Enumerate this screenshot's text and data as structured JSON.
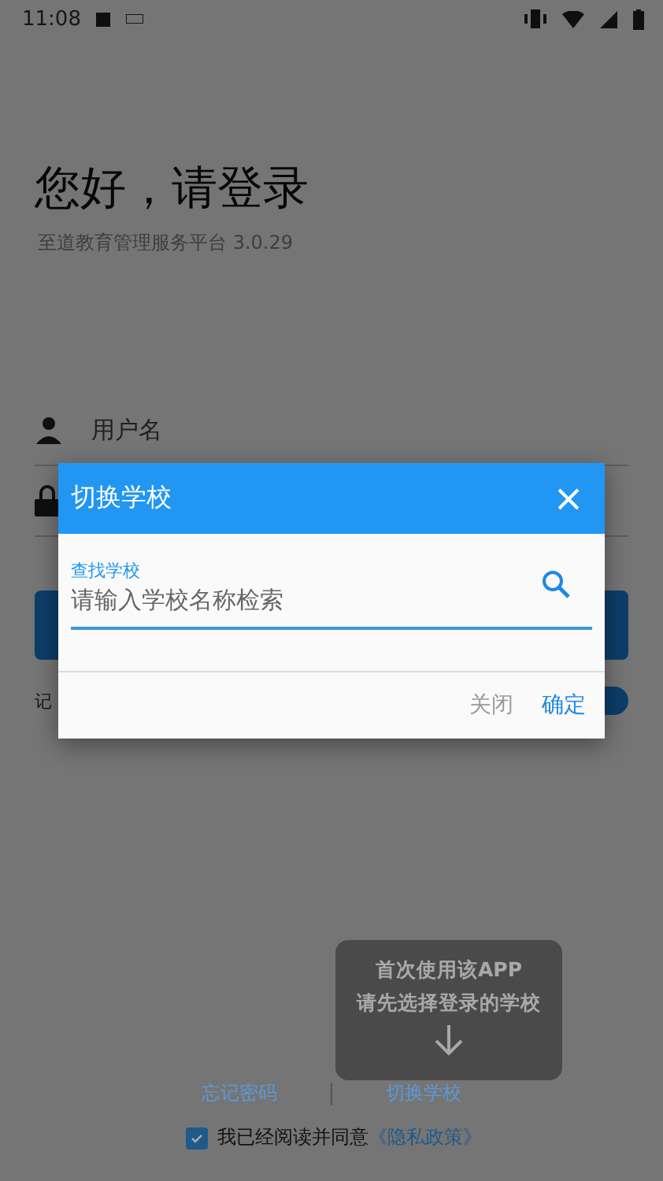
{
  "status_bar": {
    "time": "11:08"
  },
  "login": {
    "title": "您好，请登录",
    "subtitle": "至道教育管理服务平台 3.0.29",
    "username_placeholder": "用户名",
    "remember_label": "记",
    "remember_on": true
  },
  "dialog": {
    "title": "切换学校",
    "search_label": "查找学校",
    "search_placeholder": "请输入学校名称检索",
    "buttons": [
      {
        "label": "关闭",
        "kind": "secondary"
      },
      {
        "label": "确定",
        "kind": "primary"
      }
    ]
  },
  "tooltip": {
    "lines": [
      "首次使用该APP",
      "请先选择登录的学校"
    ]
  },
  "links": [
    "忘记密码",
    "切换学校"
  ],
  "agreement": {
    "checked": true,
    "text": "我已经阅读并同意",
    "link": "《隐私政策》"
  }
}
